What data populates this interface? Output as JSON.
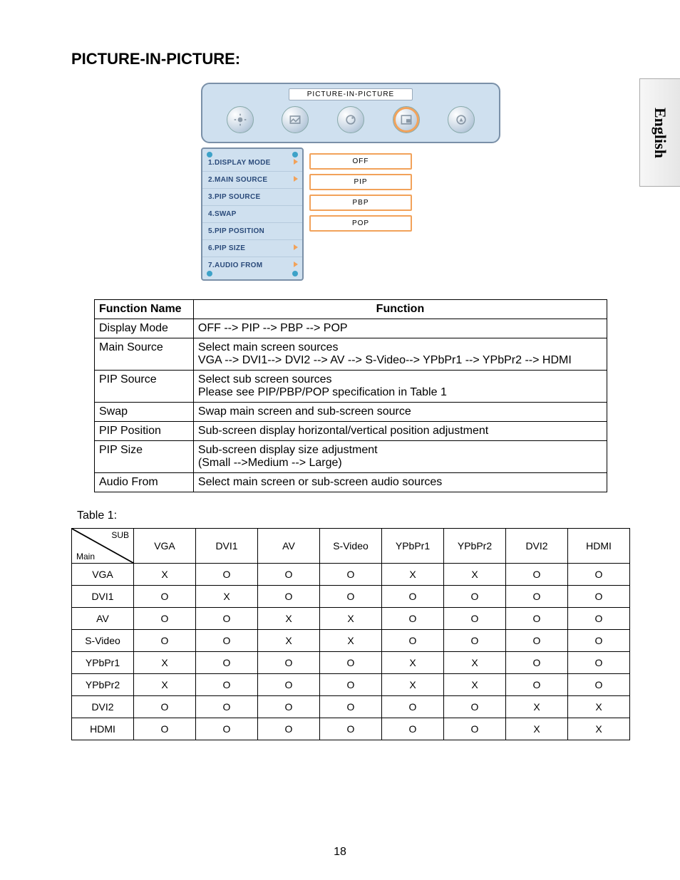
{
  "heading": "PICTURE-IN-PICTURE:",
  "language_tab": "English",
  "osd": {
    "title": "PICTURE-IN-PICTURE",
    "menu_items": [
      {
        "label": "1.DISPLAY MODE",
        "has_arrow": true
      },
      {
        "label": "2.MAIN SOURCE",
        "has_arrow": true
      },
      {
        "label": "3.PIP SOURCE",
        "has_arrow": false
      },
      {
        "label": "4.SWAP",
        "has_arrow": false
      },
      {
        "label": "5.PIP POSITION",
        "has_arrow": false
      },
      {
        "label": "6.PIP SIZE",
        "has_arrow": true
      },
      {
        "label": "7.AUDIO FROM",
        "has_arrow": true
      }
    ],
    "options": [
      "OFF",
      "PIP",
      "PBP",
      "POP"
    ]
  },
  "func_table": {
    "headers": [
      "Function Name",
      "Function"
    ],
    "rows": [
      {
        "name": "Display Mode",
        "desc": "OFF --> PIP --> PBP --> POP"
      },
      {
        "name": "Main Source",
        "desc": "Select main screen sources\nVGA --> DVI1--> DVI2 --> AV --> S-Video--> YPbPr1 --> YPbPr2 --> HDMI"
      },
      {
        "name": "PIP Source",
        "desc": "Select sub screen sources\nPlease see PIP/PBP/POP specification in Table 1"
      },
      {
        "name": "Swap",
        "desc": "Swap main screen and sub-screen source"
      },
      {
        "name": "PIP Position",
        "desc": "Sub-screen display horizontal/vertical position adjustment"
      },
      {
        "name": "PIP Size",
        "desc": "Sub-screen display size adjustment\n(Small -->Medium --> Large)"
      },
      {
        "name": "Audio From",
        "desc": "Select main screen or sub-screen audio sources"
      }
    ]
  },
  "table1_label": "Table 1:",
  "matrix": {
    "corner_sub": "SUB",
    "corner_main": "Main",
    "cols": [
      "VGA",
      "DVI1",
      "AV",
      "S-Video",
      "YPbPr1",
      "YPbPr2",
      "DVI2",
      "HDMI"
    ],
    "rows": [
      "VGA",
      "DVI1",
      "AV",
      "S-Video",
      "YPbPr1",
      "YPbPr2",
      "DVI2",
      "HDMI"
    ],
    "cells": [
      [
        "X",
        "O",
        "O",
        "O",
        "X",
        "X",
        "O",
        "O"
      ],
      [
        "O",
        "X",
        "O",
        "O",
        "O",
        "O",
        "O",
        "O"
      ],
      [
        "O",
        "O",
        "X",
        "X",
        "O",
        "O",
        "O",
        "O"
      ],
      [
        "O",
        "O",
        "X",
        "X",
        "O",
        "O",
        "O",
        "O"
      ],
      [
        "X",
        "O",
        "O",
        "O",
        "X",
        "X",
        "O",
        "O"
      ],
      [
        "X",
        "O",
        "O",
        "O",
        "X",
        "X",
        "O",
        "O"
      ],
      [
        "O",
        "O",
        "O",
        "O",
        "O",
        "O",
        "X",
        "X"
      ],
      [
        "O",
        "O",
        "O",
        "O",
        "O",
        "O",
        "X",
        "X"
      ]
    ]
  },
  "page_number": "18"
}
